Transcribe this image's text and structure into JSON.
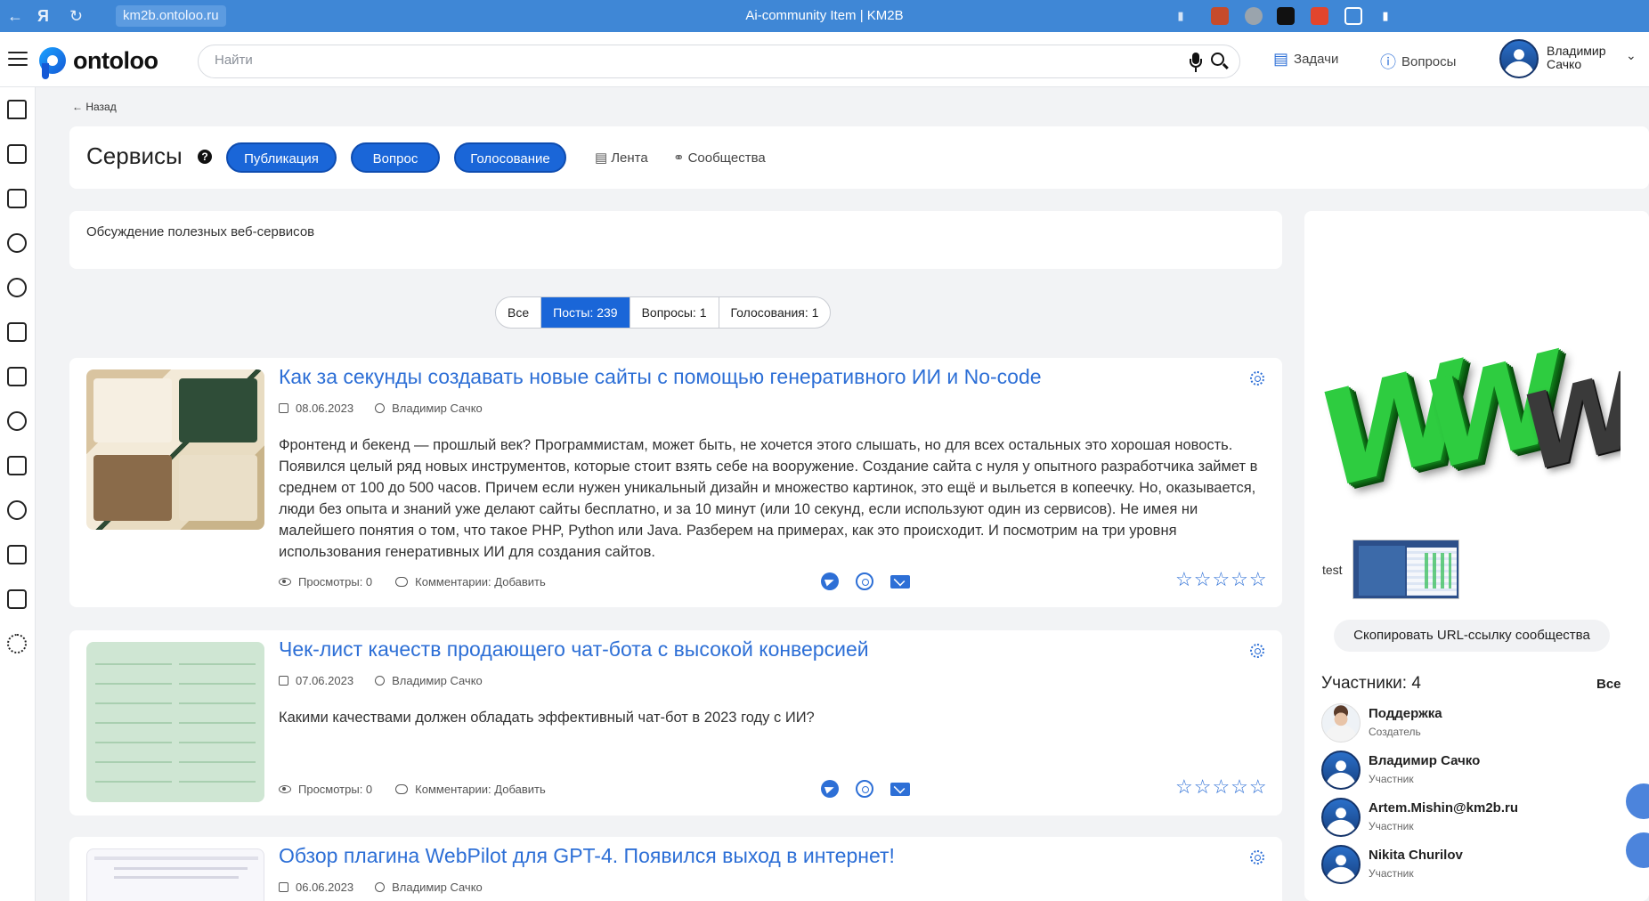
{
  "browser": {
    "url": "km2b.ontoloo.ru",
    "title": "Ai-community Item | KM2B"
  },
  "header": {
    "logo_text": "ontoloo",
    "search_placeholder": "Найти",
    "tasks_label": "Задачи",
    "questions_label": "Вопросы",
    "user_first": "Владимир",
    "user_last": "Сачко"
  },
  "back_label": "← Назад",
  "community": {
    "title": "Сервисы",
    "help": "?",
    "buttons": [
      "Публикация",
      "Вопрос",
      "Голосование"
    ],
    "feed_link": "Лента",
    "communities_link": "Сообщества",
    "description": "Обсуждение полезных веб-сервисов"
  },
  "filter_tabs": [
    {
      "label": "Все",
      "active": false
    },
    {
      "label": "Посты: 239",
      "active": true
    },
    {
      "label": "Вопросы: 1",
      "active": false
    },
    {
      "label": "Голосования: 1",
      "active": false
    }
  ],
  "posts": [
    {
      "title": "Как за секунды создавать новые сайты с помощью генеративного ИИ и No-code",
      "date": "08.06.2023",
      "author": "Владимир Сачко",
      "text": "Фронтенд и бекенд — прошлый век? Программистам, может быть, не хочется этого слышать, но для всех остальных это хорошая новость. Появился целый ряд новых инструментов, которые стоит взять себе на вооружение. Создание сайта с нуля у опытного разработчика займет в среднем от 100 до 500 часов. Причем если нужен уникальный дизайн и множество картинок, это ещё и выльется в копеечку. Но, оказывается, люди без опыта и знаний уже делают сайты бесплатно, и за 10 минут (или 10 секунд, если используют один из сервисов). Не имея ни малейшего понятия о том, что такое PHP, Python или Java. Разберем на примерах, как это происходит. И посмотрим на три уровня использования генеративных ИИ для создания сайтов.",
      "views": "Просмотры: 0",
      "comments": "Комментарии: Добавить",
      "rating": "☆☆☆☆☆"
    },
    {
      "title": "Чек-лист качеств продающего чат-бота с высокой конверсией",
      "date": "07.06.2023",
      "author": "Владимир Сачко",
      "text": "Какими качествами должен обладать эффективный чат-бот в 2023 году с ИИ?",
      "views": "Просмотры: 0",
      "comments": "Комментарии: Добавить",
      "rating": "☆☆☆☆☆"
    },
    {
      "title": "Обзор плагина WebPilot для GPT-4. Появился выход в интернет!",
      "date": "06.06.2023",
      "author": "Владимир Сачко"
    }
  ],
  "sidebar": {
    "banner_text": "WWW",
    "test_label": "test",
    "copy_url_label": "Скопировать URL-ссылку сообщества",
    "participants_title": "Участники: 4",
    "participants_all": "Все",
    "members": [
      {
        "name": "Поддержка",
        "role": "Создатель"
      },
      {
        "name": "Владимир  Сачко",
        "role": "Участник"
      },
      {
        "name": "Artem.Mishin@km2b.ru",
        "role": "Участник"
      },
      {
        "name": "Nikita Churilov",
        "role": "Участник"
      }
    ]
  },
  "colors": {
    "accent": "#1a66d8",
    "link": "#2d6fd6",
    "browser_bar": "#3f87d6"
  }
}
